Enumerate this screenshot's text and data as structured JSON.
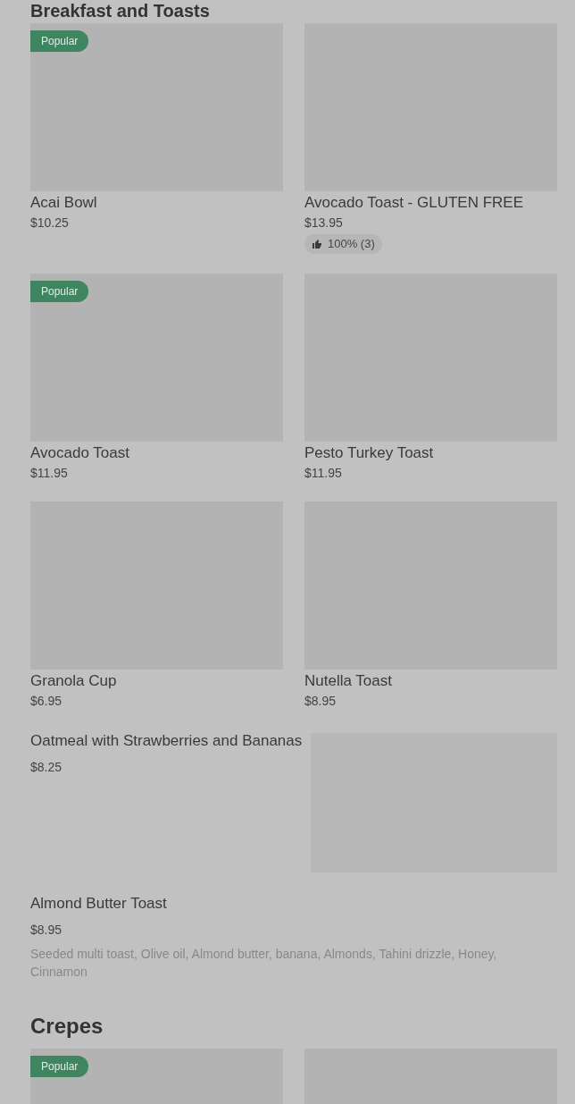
{
  "sections": [
    {
      "title": "Breakfast and Toasts",
      "items": [
        {
          "kind": "card",
          "name": "Acai Bowl",
          "price": "$10.25",
          "badge": "Popular"
        },
        {
          "kind": "card",
          "name": "Avocado Toast - GLUTEN FREE",
          "price": "$13.95",
          "rating": "100% (3)"
        },
        {
          "kind": "card",
          "name": "Avocado Toast",
          "price": "$11.95",
          "badge": "Popular"
        },
        {
          "kind": "card",
          "name": "Pesto Turkey Toast",
          "price": "$11.95"
        },
        {
          "kind": "card",
          "name": "Granola Cup",
          "price": "$6.95"
        },
        {
          "kind": "card",
          "name": "Nutella Toast",
          "price": "$8.95"
        },
        {
          "kind": "wide",
          "name": "Oatmeal with Strawberries and Bananas",
          "price": "$8.25"
        },
        {
          "kind": "text",
          "name": "Almond Butter Toast",
          "price": "$8.95",
          "description": "Seeded multi toast, Olive oil, Almond butter, banana, Almonds, Tahini drizzle, Honey, Cinnamon"
        }
      ]
    },
    {
      "title": "Crepes",
      "items": [
        {
          "kind": "card",
          "badge": "Popular"
        },
        {
          "kind": "card"
        }
      ]
    }
  ]
}
